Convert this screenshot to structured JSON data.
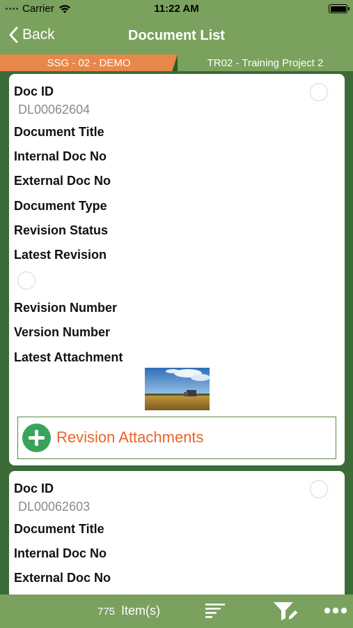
{
  "status_bar": {
    "carrier": "Carrier",
    "time": "11:22 AM"
  },
  "nav": {
    "back_label": "Back",
    "title": "Document List"
  },
  "projects": {
    "active": "SSG - 02 - DEMO",
    "other": "TR02 - Training Project 2"
  },
  "labels": {
    "doc_id": "Doc ID",
    "document_title": "Document Title",
    "internal_doc_no": "Internal Doc No",
    "external_doc_no": "External Doc No",
    "document_type": "Document Type",
    "revision_status": "Revision Status",
    "latest_revision": "Latest Revision",
    "revision_number": "Revision Number",
    "version_number": "Version Number",
    "latest_attachment": "Latest Attachment",
    "revision_attachments": "Revision Attachments"
  },
  "documents": [
    {
      "doc_id": "DL00062604"
    },
    {
      "doc_id": "DL00062603"
    }
  ],
  "footer": {
    "item_count": "775",
    "items_label": "Item(s)"
  },
  "icons": [
    "chevron-left-icon",
    "wifi-icon",
    "battery-icon",
    "sort-icon",
    "filter-edit-icon",
    "more-icon",
    "plus-icon"
  ],
  "colors": {
    "bar_green": "#7aa15d",
    "active_project": "#e8874a",
    "accent_orange": "#e8642a",
    "plus_green": "#3aa35a"
  }
}
